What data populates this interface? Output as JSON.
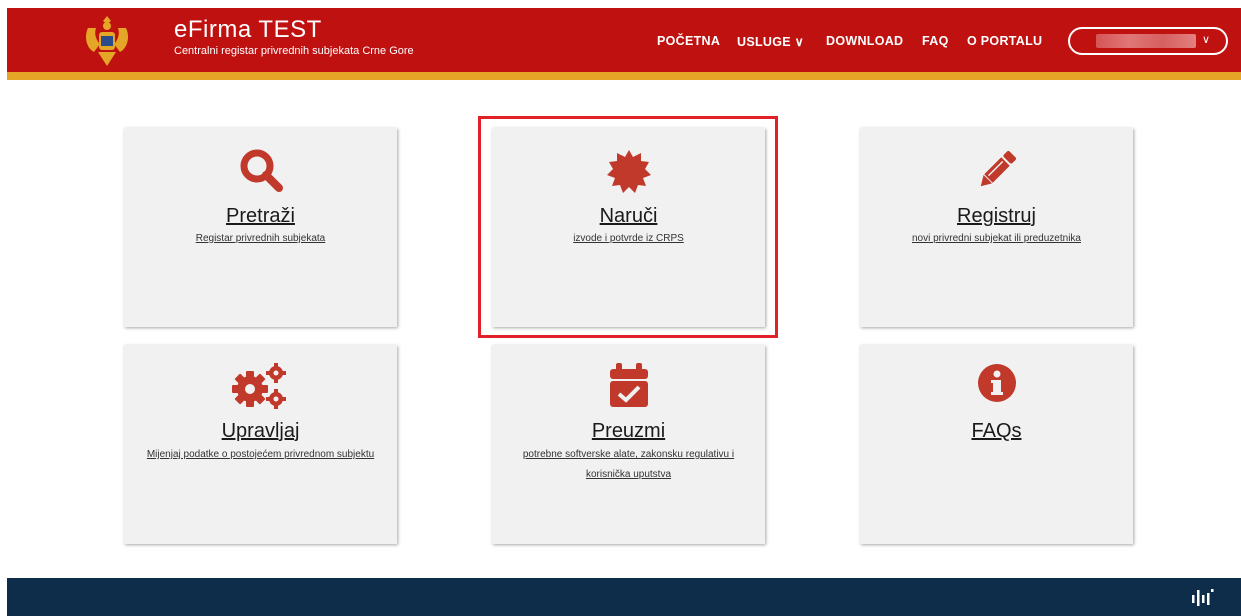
{
  "colors": {
    "header_bg": "#c01111",
    "header_stripe": "#e5a628",
    "icon_red": "#c0392b",
    "footer_bg": "#0d2d4a",
    "highlight": "#e0212a"
  },
  "header": {
    "title": "eFirma TEST",
    "subtitle": "Centralni registar privrednih subjekata Crne Gore",
    "nav": [
      {
        "label": "POČETNA"
      },
      {
        "label": "USLUGE ∨"
      },
      {
        "label": "DOWNLOAD"
      },
      {
        "label": "FAQ"
      },
      {
        "label": "O PORTALU"
      }
    ],
    "user_menu": {
      "chevron": "∨"
    }
  },
  "cards": [
    {
      "icon": "search-icon",
      "title": "Pretraži",
      "desc": "Registar privrednih subjekata"
    },
    {
      "icon": "badge-icon",
      "title": "Naruči",
      "desc": "izvode i potvrde iz CRPS"
    },
    {
      "icon": "pencil-icon",
      "title": "Registruj",
      "desc": "novi privredni subjekat ili preduzetnika"
    },
    {
      "icon": "gears-icon",
      "title": "Upravljaj",
      "desc": "Mijenjaj podatke o postojećem privrednom subjektu"
    },
    {
      "icon": "calendar-check-icon",
      "title": "Preuzmi",
      "desc": "potrebne softverske alate, zakonsku regulativu i korisnička uputstva"
    },
    {
      "icon": "info-icon",
      "title": "FAQs",
      "desc": ""
    }
  ]
}
